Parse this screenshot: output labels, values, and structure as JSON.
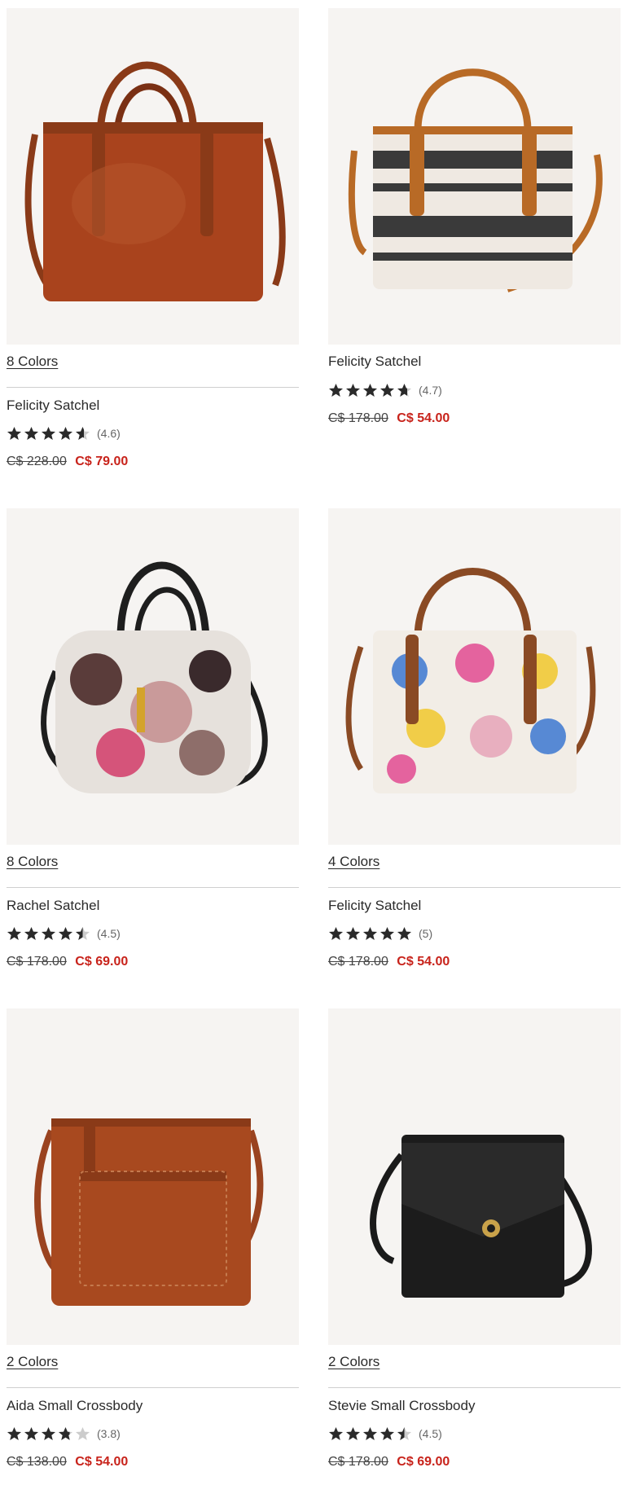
{
  "colors": {
    "sale": "#c8231b",
    "star": "#2a2a2a",
    "star_empty": "#cccccc"
  },
  "products": [
    {
      "colors_link": "8 Colors",
      "name": "Felicity Satchel",
      "rating": 4.6,
      "rating_label": "(4.6)",
      "original_price": "C$ 228.00",
      "sale_price": "C$ 79.00",
      "image": "brown-leather-satchel"
    },
    {
      "colors_link": "",
      "name": "Felicity Satchel",
      "rating": 4.7,
      "rating_label": "(4.7)",
      "original_price": "C$ 178.00",
      "sale_price": "C$ 54.00",
      "image": "striped-satchel"
    },
    {
      "colors_link": "8 Colors",
      "name": "Rachel Satchel",
      "rating": 4.5,
      "rating_label": "(4.5)",
      "original_price": "C$ 178.00",
      "sale_price": "C$ 69.00",
      "image": "floral-barrel-satchel"
    },
    {
      "colors_link": "4 Colors",
      "name": "Felicity Satchel",
      "rating": 5,
      "rating_label": "(5)",
      "original_price": "C$ 178.00",
      "sale_price": "C$ 54.00",
      "image": "floral-print-satchel"
    },
    {
      "colors_link": "2 Colors",
      "name": "Aida Small Crossbody",
      "rating": 3.8,
      "rating_label": "(3.8)",
      "original_price": "C$ 138.00",
      "sale_price": "C$ 54.00",
      "image": "brown-crossbody"
    },
    {
      "colors_link": "2 Colors",
      "name": "Stevie Small Crossbody",
      "rating": 4.5,
      "rating_label": "(4.5)",
      "original_price": "C$ 178.00",
      "sale_price": "C$ 69.00",
      "image": "black-crossbody"
    }
  ]
}
